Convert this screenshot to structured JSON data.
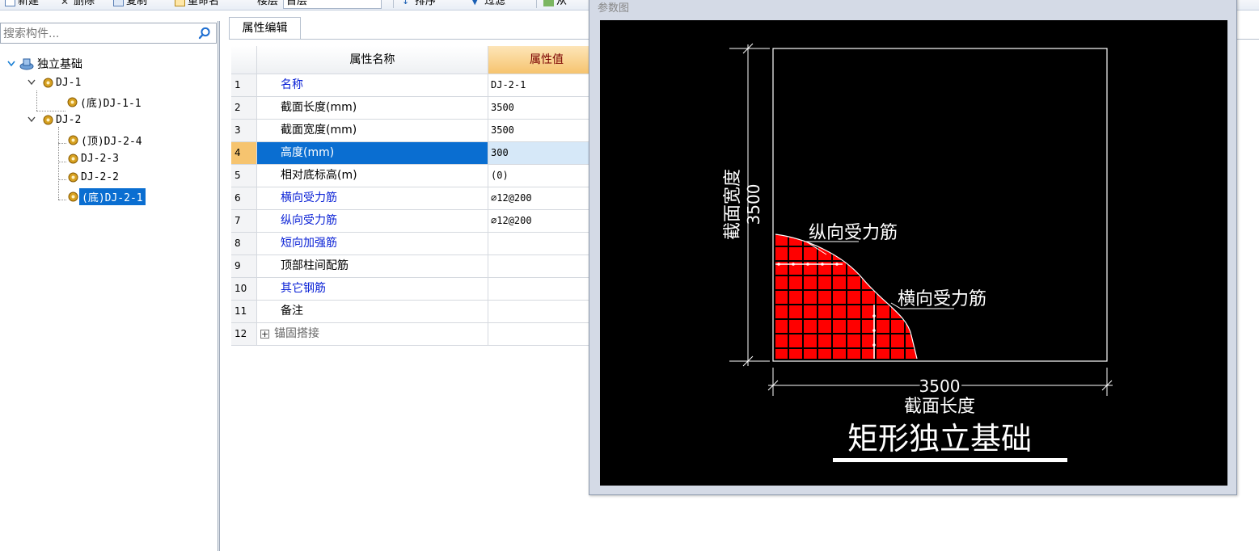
{
  "toolbar": {
    "items": [
      {
        "label": "新建"
      },
      {
        "label": "删除"
      },
      {
        "label": "复制"
      },
      {
        "label": "重命名"
      },
      {
        "label": "楼层"
      },
      {
        "label": "排序"
      },
      {
        "label": "过滤"
      },
      {
        "label": "从"
      }
    ],
    "floor_value": "首层"
  },
  "search": {
    "placeholder": "搜索构件..."
  },
  "tree": {
    "root": "独立基础",
    "nodes": [
      {
        "label": "DJ-1"
      },
      {
        "label": "(底)DJ-1-1"
      },
      {
        "label": "DJ-2"
      },
      {
        "label": "(顶)DJ-2-4"
      },
      {
        "label": "DJ-2-3"
      },
      {
        "label": "DJ-2-2"
      },
      {
        "label": "(底)DJ-2-1"
      }
    ]
  },
  "tab": {
    "label": "属性编辑"
  },
  "grid": {
    "headers": {
      "name": "属性名称",
      "value": "属性值"
    },
    "rows": [
      {
        "num": "1",
        "name": "名称",
        "value": "DJ-2-1"
      },
      {
        "num": "2",
        "name": "截面长度(mm)",
        "value": "3500"
      },
      {
        "num": "3",
        "name": "截面宽度(mm)",
        "value": "3500"
      },
      {
        "num": "4",
        "name": "高度(mm)",
        "value": "300"
      },
      {
        "num": "5",
        "name": "相对底标高(m)",
        "value": "(0)"
      },
      {
        "num": "6",
        "name": "横向受力筋",
        "value": "⌀12@200"
      },
      {
        "num": "7",
        "name": "纵向受力筋",
        "value": "⌀12@200"
      },
      {
        "num": "8",
        "name": "短向加强筋",
        "value": ""
      },
      {
        "num": "9",
        "name": "顶部柱间配筋",
        "value": ""
      },
      {
        "num": "10",
        "name": "其它钢筋",
        "value": ""
      },
      {
        "num": "11",
        "name": "备注",
        "value": ""
      },
      {
        "num": "12",
        "name": "锚固搭接",
        "value": ""
      }
    ]
  },
  "dialog": {
    "title": "参数图",
    "drawing": {
      "width_label": "截面宽度",
      "width_value": "3500",
      "length_label": "截面长度",
      "length_value": "3500",
      "label_longitudinal": "纵向受力筋",
      "label_transverse": "横向受力筋",
      "caption": "矩形独立基础"
    }
  },
  "colors": {
    "selection": "#0a6ed1",
    "link_text": "#0b22d6",
    "rebar": "#ff0000",
    "header_value_bg": "#f6c46f"
  }
}
